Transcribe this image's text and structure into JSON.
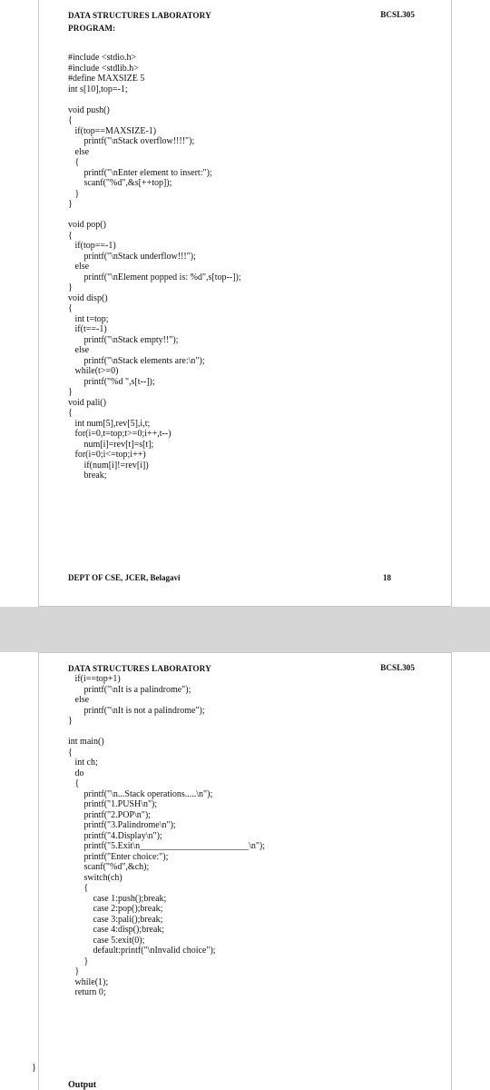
{
  "page1": {
    "header_left": "DATA STRUCTURES LABORATORY",
    "header_right": "BCSL305",
    "program_label": "PROGRAM:",
    "code_lines": [
      "#include <stdio.h>",
      "#include <stdlib.h>",
      "#define MAXSIZE 5",
      "int s[10],top=-1;",
      "",
      "void push()",
      "{",
      "   if(top==MAXSIZE-1)",
      "       printf(\"\\nStack overflow!!!!\");",
      "   else",
      "   {",
      "       printf(\"\\nEnter element to insert:\");",
      "       scanf(\"%d\",&s[++top]);",
      "   }",
      "}",
      "",
      "void pop()",
      "{",
      "   if(top==-1)",
      "       printf(\"\\nStack underflow!!!\");",
      "   else",
      "       printf(\"\\nElement popped is: %d\",s[top--]);",
      "}",
      "void disp()",
      "{",
      "   int t=top;",
      "   if(t==-1)",
      "       printf(\"\\nStack empty!!\");",
      "   else",
      "       printf(\"\\nStack elements are:\\n\");",
      "   while(t>=0)",
      "       printf(\"%d \",s[t--]);",
      "}",
      "void pali()",
      "{",
      "   int num[5],rev[5],i,t;",
      "   for(i=0,t=top;t>=0;i++,t--)",
      "       num[i]=rev[t]=s[t];",
      "   for(i=0;i<=top;i++)",
      "       if(num[i]!=rev[i])",
      "       break;"
    ],
    "footer_left": "DEPT OF CSE, JCER, Belagavi",
    "footer_page": "18"
  },
  "page2": {
    "header_left": "DATA STRUCTURES LABORATORY",
    "header_right": "BCSL305",
    "code_lines": [
      "   if(i==top+1)",
      "       printf(\"\\nIt is a palindrome\");",
      "   else",
      "       printf(\"\\nIt is not a palindrome\");",
      "}",
      "",
      "int main()",
      "{",
      "   int ch;",
      "   do",
      "   {",
      "       printf(\"\\n...Stack operations.....\\n\");",
      "       printf(\"1.PUSH\\n\");",
      "       printf(\"2.POP\\n\");",
      "       printf(\"3.Palindrome\\n\");",
      "       printf(\"4.Display\\n\");",
      "       printf(\"5.Exit\\n________________________\\n\");",
      "       printf(\"Enter choice:\");",
      "       scanf(\"%d\",&ch);",
      "       switch(ch)",
      "       {",
      "           case 1:push();break;",
      "           case 2:pop();break;",
      "           case 3:pali();break;",
      "           case 4:disp();break;",
      "           case 5:exit(0);",
      "           default:printf(\"\\nInvalid choice\");",
      "       }",
      "   }",
      "   while(1);",
      "   return 0;"
    ],
    "closing_brace": "}",
    "output_label": "Output"
  }
}
